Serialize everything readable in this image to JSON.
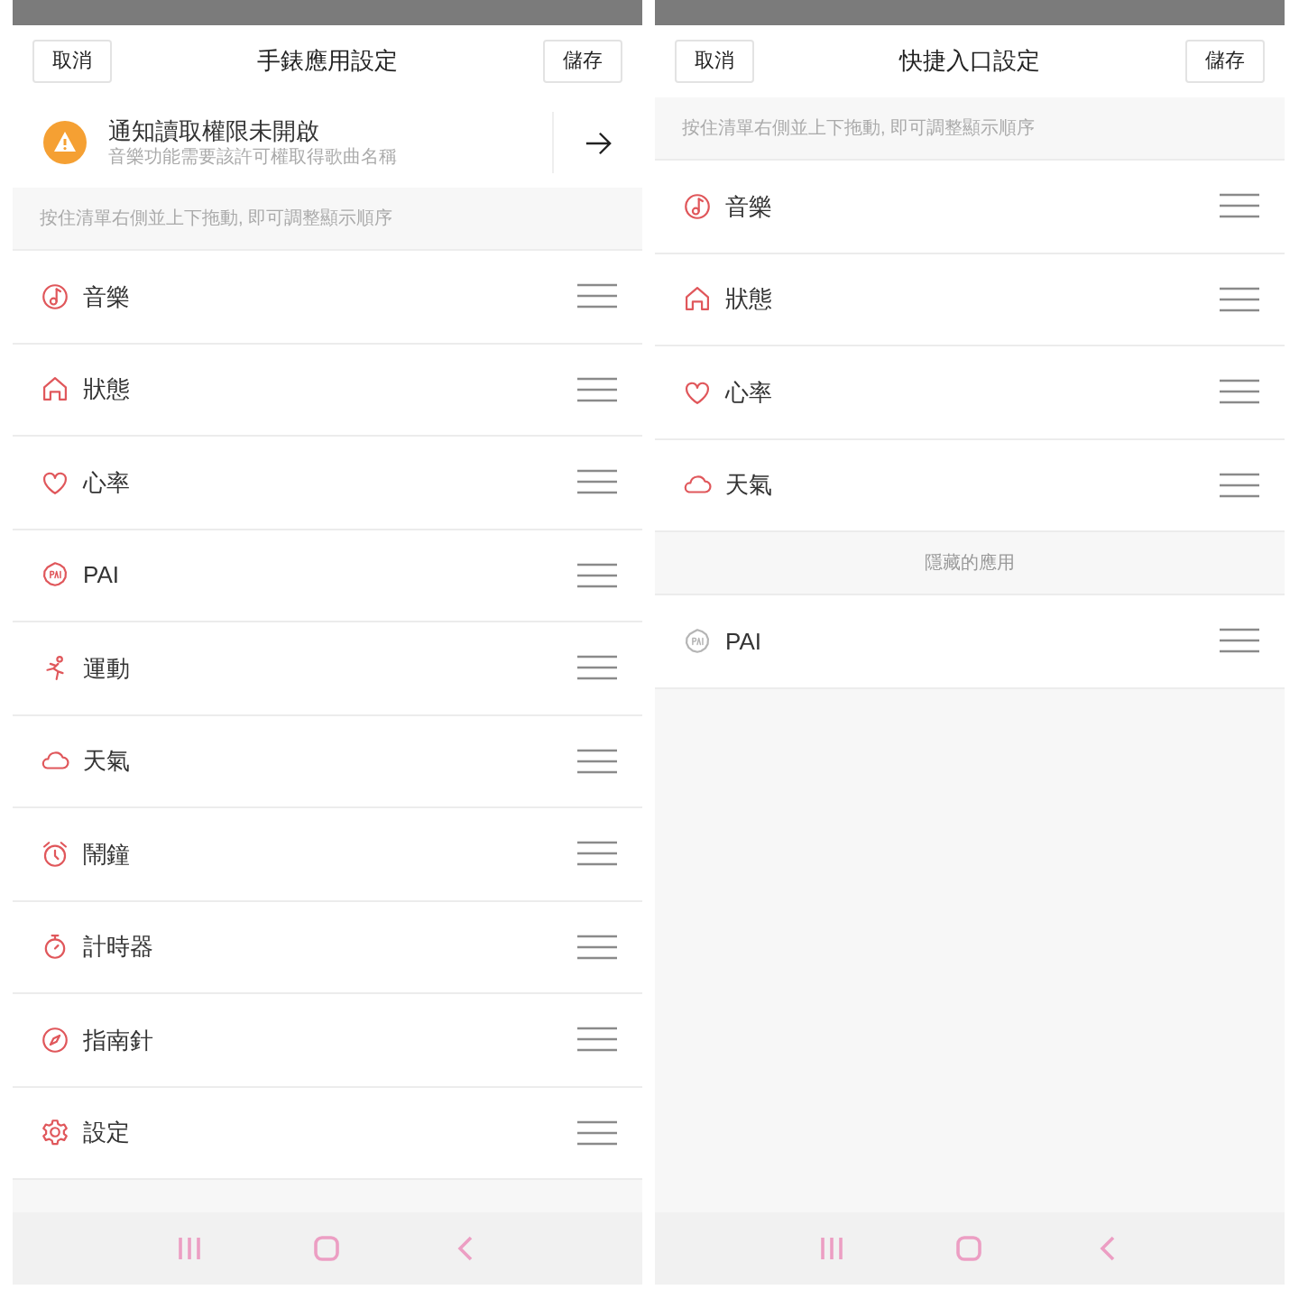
{
  "screens": [
    {
      "header": {
        "cancel": "取消",
        "title": "手錶應用設定",
        "save": "儲存"
      },
      "notice": {
        "title": "通知讀取權限未開啟",
        "subtitle": "音樂功能需要該許可權取得歌曲名稱"
      },
      "hint": "按住清單右側並上下拖動, 即可調整顯示順序",
      "items": [
        {
          "label": "音樂",
          "kind": "music"
        },
        {
          "label": "狀態",
          "kind": "home"
        },
        {
          "label": "心率",
          "kind": "heart"
        },
        {
          "label": "PAI",
          "kind": "pai"
        },
        {
          "label": "運動",
          "kind": "run"
        },
        {
          "label": "天氣",
          "kind": "cloud"
        },
        {
          "label": "鬧鐘",
          "kind": "alarm"
        },
        {
          "label": "計時器",
          "kind": "timer"
        },
        {
          "label": "指南針",
          "kind": "compass"
        },
        {
          "label": "設定",
          "kind": "gear"
        }
      ]
    },
    {
      "header": {
        "cancel": "取消",
        "title": "快捷入口設定",
        "save": "儲存"
      },
      "hint": "按住清單右側並上下拖動, 即可調整顯示順序",
      "items": [
        {
          "label": "音樂",
          "kind": "music"
        },
        {
          "label": "狀態",
          "kind": "home"
        },
        {
          "label": "心率",
          "kind": "heart"
        },
        {
          "label": "天氣",
          "kind": "cloud"
        }
      ],
      "hidden_section": {
        "title": "隱藏的應用",
        "items": [
          {
            "label": "PAI",
            "kind": "pai"
          }
        ]
      }
    }
  ]
}
